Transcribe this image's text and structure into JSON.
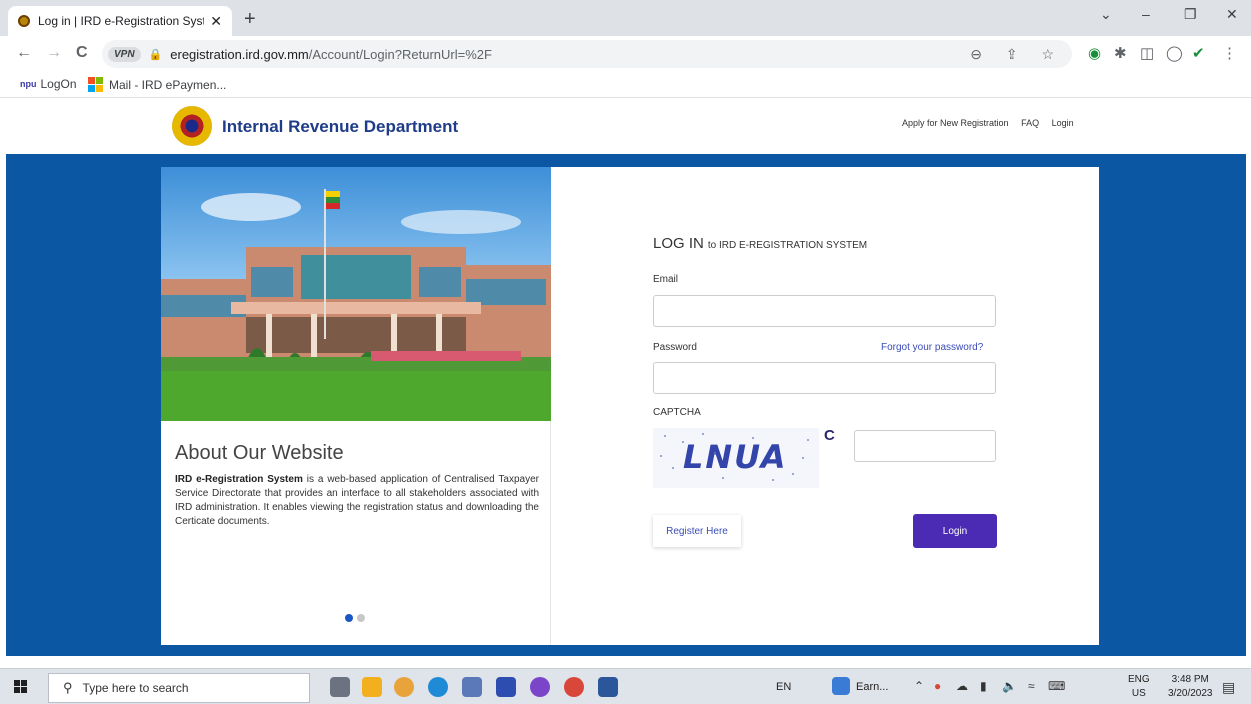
{
  "browser": {
    "tab_title": "Log in | IRD e-Registration System",
    "tab_close": "✕",
    "new_tab": "+",
    "window_controls": [
      "⌄",
      "–",
      "❐",
      "✕"
    ],
    "nav": {
      "back": "←",
      "forward": "→",
      "reload": "C"
    },
    "vpn_badge": "VPN",
    "url_host": "eregistration.ird.gov.mm",
    "url_path": "/Account/Login?ReturnUrl=%2F",
    "omnibox_icons": "⊖ ⇪ ☆",
    "bookmarks": [
      {
        "label": "LogOn",
        "icon": "npu"
      },
      {
        "label": "Mail - IRD ePaymen..."
      }
    ]
  },
  "site": {
    "brand": "Internal Revenue Department",
    "nav": [
      "Apply for New Registration",
      "FAQ",
      "Login"
    ]
  },
  "about": {
    "title": "About Our Website",
    "lead": "IRD e-Registration System",
    "body": " is a web-based application of Centralised Taxpayer Service Directorate that provides an interface to all stakeholders associated with IRD administration. It enables viewing the registration status and downloading the Certicate documents."
  },
  "login": {
    "heading": "LOG IN",
    "subheading": "to IRD E-REGISTRATION SYSTEM",
    "email_label": "Email",
    "email_value": "",
    "password_label": "Password",
    "password_value": "",
    "forgot": "Forgot your password?",
    "captcha_label": "CAPTCHA",
    "captcha_text": "LNUA",
    "captcha_refresh": "C",
    "captcha_value": "",
    "register": "Register Here",
    "submit": "Login"
  },
  "taskbar": {
    "search_placeholder": "Type here to search",
    "input_lang": "EN",
    "earn_label": "Earn...",
    "lang_line1": "ENG",
    "lang_line2": "US",
    "time": "3:48 PM",
    "date": "3/20/2023"
  },
  "colors": {
    "band": "#0b57a4",
    "brand": "#1f3c88",
    "login_button": "#4b2bb3",
    "link": "#3b4cb8"
  }
}
